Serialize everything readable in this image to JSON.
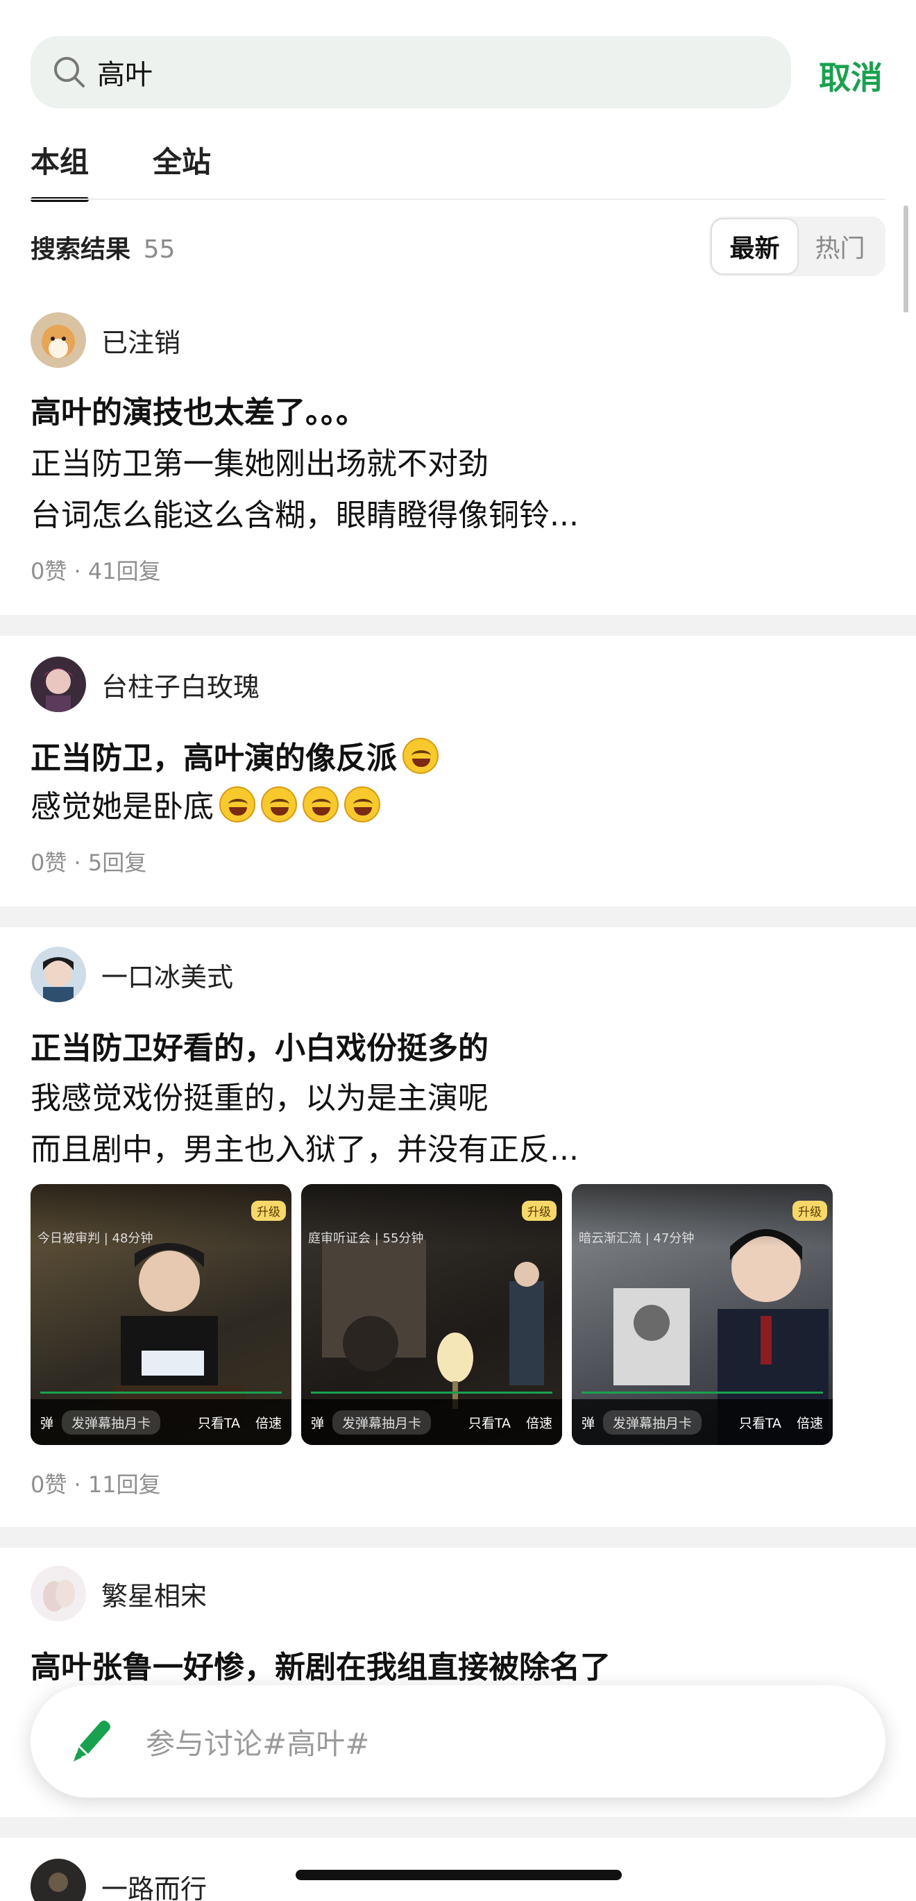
{
  "search": {
    "query": "高叶",
    "cancel_label": "取消"
  },
  "tabs": [
    {
      "label": "本组",
      "active": true
    },
    {
      "label": "全站",
      "active": false
    }
  ],
  "results": {
    "label": "搜索结果",
    "count": "55"
  },
  "sort": [
    {
      "label": "最新",
      "active": true
    },
    {
      "label": "热门",
      "active": false
    }
  ],
  "posts": [
    {
      "author": "已注销",
      "lines": [
        "高叶的演技也太差了。。。",
        "正当防卫第一集她刚出场就不对劲",
        "台词怎么能这么含糊，眼睛瞪得像铜铃..."
      ],
      "stats": "0赞 · 41回复"
    },
    {
      "author": "台柱子白玫瑰",
      "lines": [
        "正当防卫，高叶演的像反派",
        "感觉她是卧底"
      ],
      "stats": "0赞 · 5回复"
    },
    {
      "author": "一口冰美式",
      "lines": [
        "正当防卫好看的，小白戏份挺多的",
        "我感觉戏份挺重的，以为是主演呢",
        "而且剧中，男主也入狱了，并没有正反..."
      ],
      "thumbs": [
        {
          "tag": "升级",
          "caption": "今日被审判 | 48分钟",
          "danmaku": "发弹幕抽月卡",
          "only_ta": "只看TA",
          "speed": "倍速",
          "dan": "弹"
        },
        {
          "tag": "升级",
          "caption": "庭审听证会 | 55分钟",
          "danmaku": "发弹幕抽月卡",
          "only_ta": "只看TA",
          "speed": "倍速",
          "dan": "弹"
        },
        {
          "tag": "升级",
          "caption": "暗云渐汇流 | 47分钟",
          "danmaku": "发弹幕抽月卡",
          "only_ta": "只看TA",
          "speed": "倍速",
          "dan": "弹"
        }
      ],
      "stats": "0赞 · 11回复"
    },
    {
      "author": "繁星相宋",
      "lines": [
        "高叶张鲁一好惨，新剧在我组直接被除名了"
      ],
      "stats": ""
    },
    {
      "author": "一路而行",
      "lines": [],
      "stats": ""
    }
  ],
  "compose": {
    "placeholder": "参与讨论#高叶#"
  },
  "colors": {
    "accent": "#1aa14f",
    "divider": "#f2f2f2"
  }
}
